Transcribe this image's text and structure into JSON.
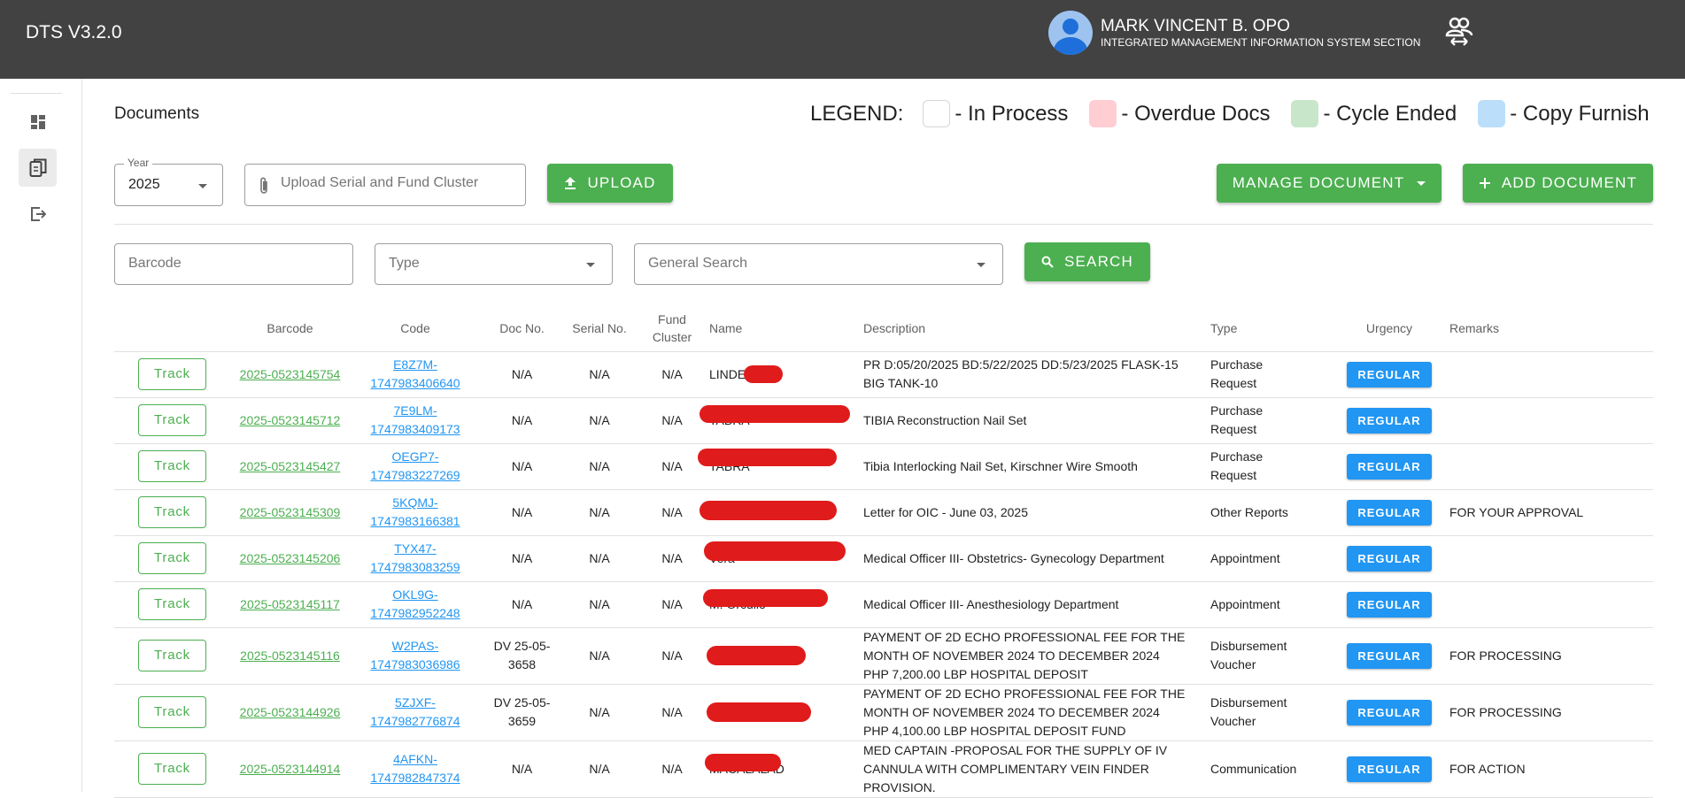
{
  "app": {
    "title": "DTS V3.2.0"
  },
  "user": {
    "name": "MARK VINCENT B. OPO",
    "section": "INTEGRATED MANAGEMENT INFORMATION SYSTEM SECTION"
  },
  "page": {
    "title": "Documents"
  },
  "legend": {
    "label": "LEGEND:",
    "items": [
      {
        "label": "- In Process",
        "color": "#ffffff"
      },
      {
        "label": "- Overdue Docs",
        "color": "#ffcdd2"
      },
      {
        "label": "- Cycle Ended",
        "color": "#c8e6c9"
      },
      {
        "label": "- Copy Furnish",
        "color": "#bbdefb"
      }
    ]
  },
  "toolbar": {
    "year_label": "Year",
    "year_value": "2025",
    "upload_placeholder": "Upload Serial and Fund Cluster",
    "upload_button": "UPLOAD",
    "manage_button": "MANAGE DOCUMENT",
    "add_button": "ADD DOCUMENT"
  },
  "filters": {
    "barcode_placeholder": "Barcode",
    "type_placeholder": "Type",
    "general_placeholder": "General Search",
    "search_button": "SEARCH"
  },
  "colors": {
    "green": "#4caf50",
    "blue": "#2196f3",
    "topbar": "#424242"
  },
  "table": {
    "headers": [
      "Barcode",
      "Code",
      "Doc No.",
      "Serial No.",
      "Fund Cluster",
      "Name",
      "Description",
      "Type",
      "Urgency",
      "Remarks"
    ],
    "track_label": "Track",
    "rows": [
      {
        "barcode": "2025-0523145754",
        "code1": "E8Z7M-",
        "code2": "1747983406640",
        "docno": "N/A",
        "serial": "N/A",
        "fund": "N/A",
        "name1": "LINDE",
        "name2": "",
        "desc": "PR D:05/20/2025 BD:5/22/2025 DD:5/23/2025 FLASK-15 BIG TANK-10",
        "type": "Purchase Request",
        "urgency": "REGULAR",
        "remarks": ""
      },
      {
        "barcode": "2025-0523145712",
        "code1": "7E9LM-",
        "code2": "1747983409173",
        "docno": "N/A",
        "serial": "N/A",
        "fund": "N/A",
        "name1": "",
        "name2": "TABRA",
        "desc": "TIBIA Reconstruction Nail Set",
        "type": "Purchase Request",
        "urgency": "REGULAR",
        "remarks": ""
      },
      {
        "barcode": "2025-0523145427",
        "code1": "OEGP7-",
        "code2": "1747983227269",
        "docno": "N/A",
        "serial": "N/A",
        "fund": "N/A",
        "name1": "",
        "name2": "TABRA",
        "desc": "Tibia Interlocking Nail Set, Kirschner Wire Smooth",
        "type": "Purchase Request",
        "urgency": "REGULAR",
        "remarks": ""
      },
      {
        "barcode": "2025-0523145309",
        "code1": "5KQMJ-",
        "code2": "1747983166381",
        "docno": "N/A",
        "serial": "N/A",
        "fund": "N/A",
        "name1": "",
        "name2": "",
        "desc": "Letter for OIC - June 03, 2025",
        "type": "Other Reports",
        "urgency": "REGULAR",
        "remarks": "FOR YOUR APPROVAL"
      },
      {
        "barcode": "2025-0523145206",
        "code1": "TYX47-",
        "code2": "1747983083259",
        "docno": "N/A",
        "serial": "N/A",
        "fund": "N/A",
        "name1": "",
        "name2": "Vera",
        "desc": "Medical Officer III- Obstetrics- Gynecology Department",
        "type": "Appointment",
        "urgency": "REGULAR",
        "remarks": ""
      },
      {
        "barcode": "2025-0523145117",
        "code1": "OKL9G-",
        "code2": "1747982952248",
        "docno": "N/A",
        "serial": "N/A",
        "fund": "N/A",
        "name1": "",
        "name2": "M. Orcullo",
        "desc": "Medical Officer III- Anesthesiology Department",
        "type": "Appointment",
        "urgency": "REGULAR",
        "remarks": ""
      },
      {
        "barcode": "2025-0523145116",
        "code1": "W2PAS-",
        "code2": "1747983036986",
        "docno": "DV 25-05-3658",
        "serial": "N/A",
        "fund": "N/A",
        "name1": "",
        "name2": "",
        "desc": "PAYMENT OF 2D ECHO PROFESSIONAL FEE FOR THE MONTH OF NOVEMBER 2024 TO DECEMBER 2024 PHP 7,200.00 LBP HOSPITAL DEPOSIT",
        "type": "Disbursement Voucher",
        "urgency": "REGULAR",
        "remarks": "FOR PROCESSING"
      },
      {
        "barcode": "2025-0523144926",
        "code1": "5ZJXF-",
        "code2": "1747982776874",
        "docno": "DV 25-05-3659",
        "serial": "N/A",
        "fund": "N/A",
        "name1": "",
        "name2": "",
        "desc": "PAYMENT OF 2D ECHO PROFESSIONAL FEE FOR THE MONTH OF NOVEMBER 2024 TO DECEMBER 2024 PHP 4,100.00 LBP HOSPITAL DEPOSIT FUND",
        "type": "Disbursement Voucher",
        "urgency": "REGULAR",
        "remarks": "FOR PROCESSING"
      },
      {
        "barcode": "2025-0523144914",
        "code1": "4AFKN-",
        "code2": "1747982847374",
        "docno": "N/A",
        "serial": "N/A",
        "fund": "N/A",
        "name1": "",
        "name2": "MACALALAD",
        "desc": "MED CAPTAIN -PROPOSAL FOR THE SUPPLY OF IV CANNULA WITH COMPLIMENTARY VEIN FINDER PROVISION.",
        "type": "Communication",
        "urgency": "REGULAR",
        "remarks": "FOR ACTION"
      }
    ]
  }
}
